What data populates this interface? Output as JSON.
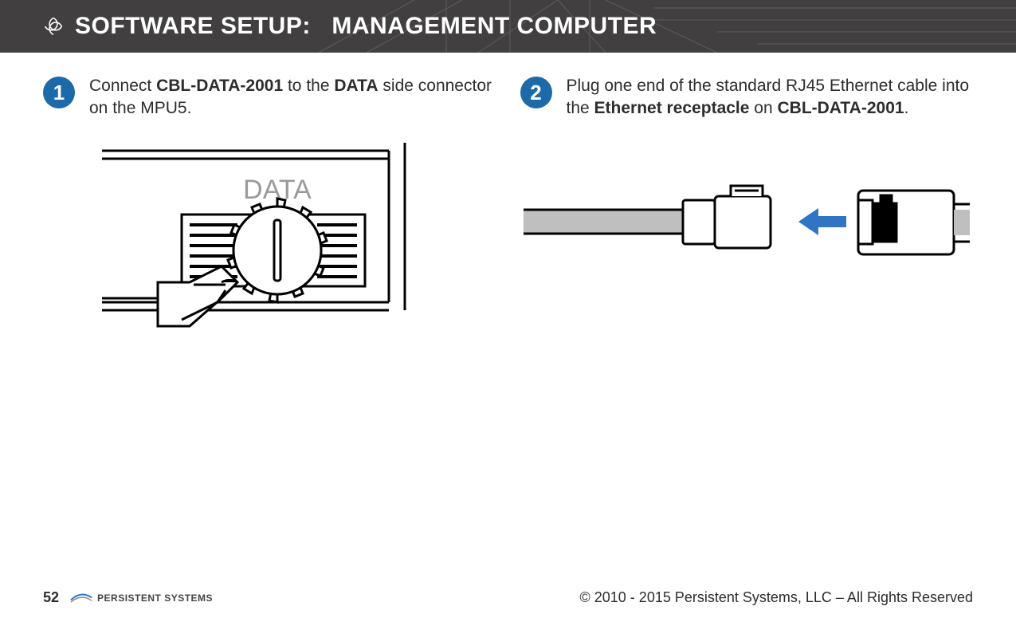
{
  "header": {
    "title_prefix": "SOFTWARE SETUP:",
    "title_suffix": "MANAGEMENT COMPUTER"
  },
  "steps": {
    "one": {
      "num": "1",
      "t1": "Connect ",
      "b1": "CBL-DATA-2001",
      "t2": " to the ",
      "b2": "DATA",
      "t3": " side connector on the MPU5."
    },
    "two": {
      "num": "2",
      "t1": "Plug one end of the standard RJ45 Ether­net cable into the ",
      "b1": "Ethernet receptacle",
      "t2": " on ",
      "b2": "CBL-DATA-2001",
      "t3": "."
    }
  },
  "diagram": {
    "data_label": "DATA"
  },
  "footer": {
    "page": "52",
    "brand": "PERSISTENT SYSTEMS",
    "copyright": "© 2010 - 2015 Persistent Systems, LLC – All Rights Reserved"
  }
}
